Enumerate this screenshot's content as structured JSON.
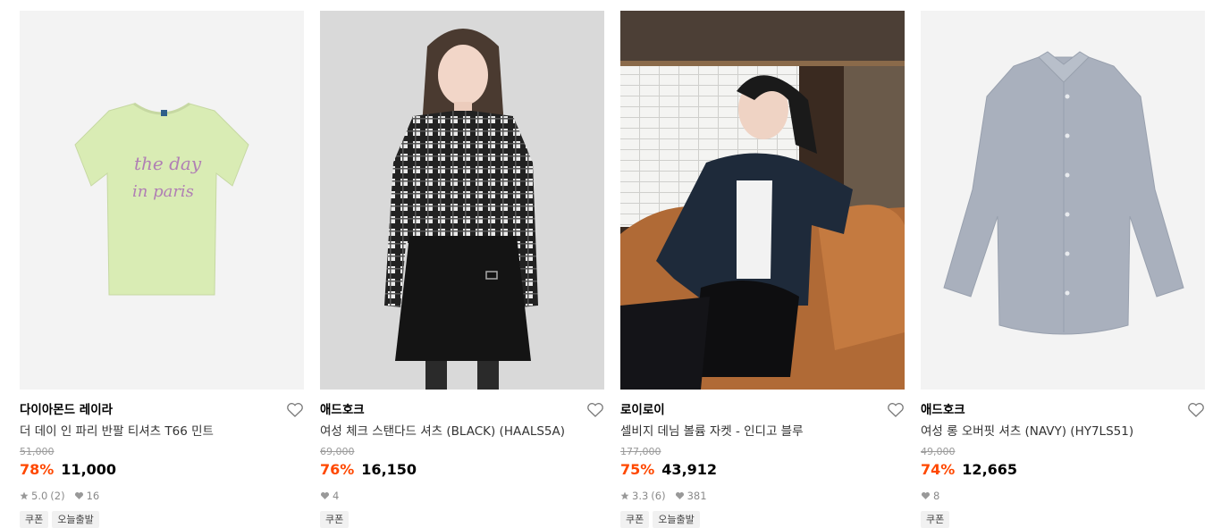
{
  "products": [
    {
      "brand": "다이아몬드 레이라",
      "name": "더 데이 인 파리 반팔 티셔츠 T66 민트",
      "original_price": "51,000",
      "discount": "78%",
      "price": "11,000",
      "rating": "5.0",
      "reviews": "(2)",
      "likes": "16",
      "tags": [
        "쿠폰",
        "오늘출발"
      ],
      "image": "mint-tshirt",
      "shirt_print": [
        "the day",
        "in paris"
      ],
      "bg": "#f3f3f3"
    },
    {
      "brand": "애드호크",
      "name": "여성 체크 스탠다드 셔츠 (BLACK) (HAALS5A)",
      "original_price": "69,000",
      "discount": "76%",
      "price": "16,150",
      "likes": "4",
      "tags": [
        "쿠폰"
      ],
      "image": "model-plaid-shirt",
      "bg": "#d9d9d9"
    },
    {
      "brand": "로이로이",
      "name": "셀비지 데님 볼륨 자켓 - 인디고 블루",
      "original_price": "177,000",
      "discount": "75%",
      "price": "43,912",
      "rating": "3.3",
      "reviews": "(6)",
      "likes": "381",
      "tags": [
        "쿠폰",
        "오늘출발"
      ],
      "image": "model-denim-jacket",
      "bg": "#7a5a3e"
    },
    {
      "brand": "애드호크",
      "name": "여성 롱 오버핏 셔츠 (NAVY) (HY7LS51)",
      "original_price": "49,000",
      "discount": "74%",
      "price": "12,665",
      "likes": "8",
      "tags": [
        "쿠폰"
      ],
      "image": "gray-shirt",
      "bg": "#f3f3f3"
    }
  ],
  "icons": {
    "like": "heart-outline-icon",
    "star": "star-icon",
    "likes_count": "heart-filled-icon"
  },
  "colors": {
    "discount": "#ff4800",
    "muted": "#9a9a9a"
  }
}
